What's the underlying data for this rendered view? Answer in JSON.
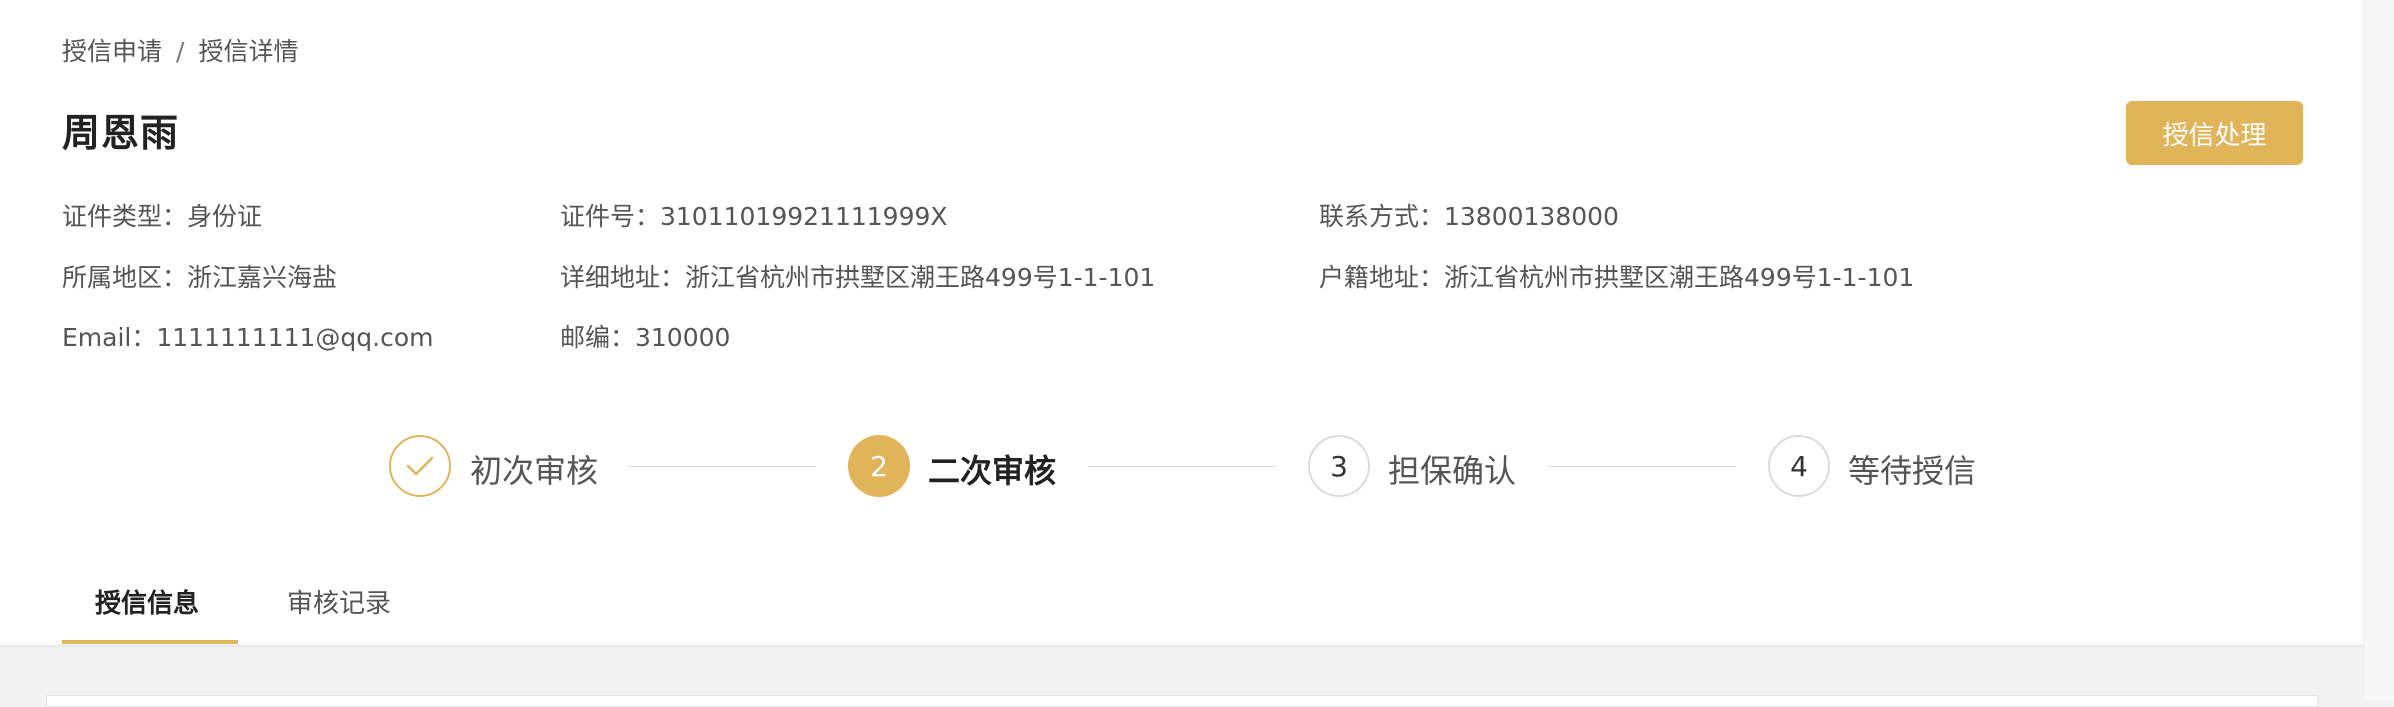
{
  "breadcrumb": {
    "parent": "授信申请",
    "separator": "/",
    "current": "授信详情"
  },
  "header": {
    "name": "周恩雨",
    "action_label": "授信处理"
  },
  "info": {
    "id_type": "证件类型：身份证",
    "id_number": "证件号：31011019921111999X",
    "contact": "联系方式：13800138000",
    "region": "所属地区：浙江嘉兴海盐",
    "address": "详细地址：浙江省杭州市拱墅区潮王路499号1-1-101",
    "household_address": "户籍地址：浙江省杭州市拱墅区潮王路499号1-1-101",
    "email": "Email：1111111111@qq.com",
    "postcode": "邮编：310000"
  },
  "steps": [
    {
      "number": "",
      "label": "初次审核",
      "status": "done",
      "icon": "check-icon"
    },
    {
      "number": "2",
      "label": "二次审核",
      "status": "active"
    },
    {
      "number": "3",
      "label": "担保确认",
      "status": "todo"
    },
    {
      "number": "4",
      "label": "等待授信",
      "status": "todo"
    }
  ],
  "tabs": [
    {
      "label": "授信信息",
      "active": true
    },
    {
      "label": "审核记录",
      "active": false
    }
  ],
  "colors": {
    "accent": "#e1b45a",
    "text_primary": "#222222",
    "text_secondary": "#555555",
    "background": "#f2f2f2"
  }
}
